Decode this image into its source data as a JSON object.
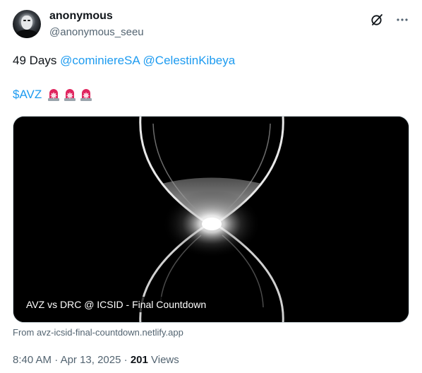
{
  "author": {
    "display_name": "anonymous",
    "handle": "@anonymous_seeu"
  },
  "tweet": {
    "line1_text": "49 Days",
    "mentions": [
      "@cominiereSA",
      "@CelestinKibeya"
    ],
    "cashtag": "$AVZ",
    "siren_count": 3
  },
  "card": {
    "title": "AVZ vs DRC @ ICSID - Final Countdown",
    "source": "From avz-icsid-final-countdown.netlify.app",
    "image_icon": "hourglass-image"
  },
  "meta": {
    "time": "8:40 AM",
    "separator": "·",
    "date": "Apr 13, 2025",
    "views_count": "201",
    "views_label": "Views"
  },
  "icons": {
    "grok": "grok-icon",
    "more": "more-icon",
    "siren": "police-light-icon"
  },
  "colors": {
    "link": "#1d9bf0",
    "text": "#0f1419",
    "secondary": "#536471"
  }
}
